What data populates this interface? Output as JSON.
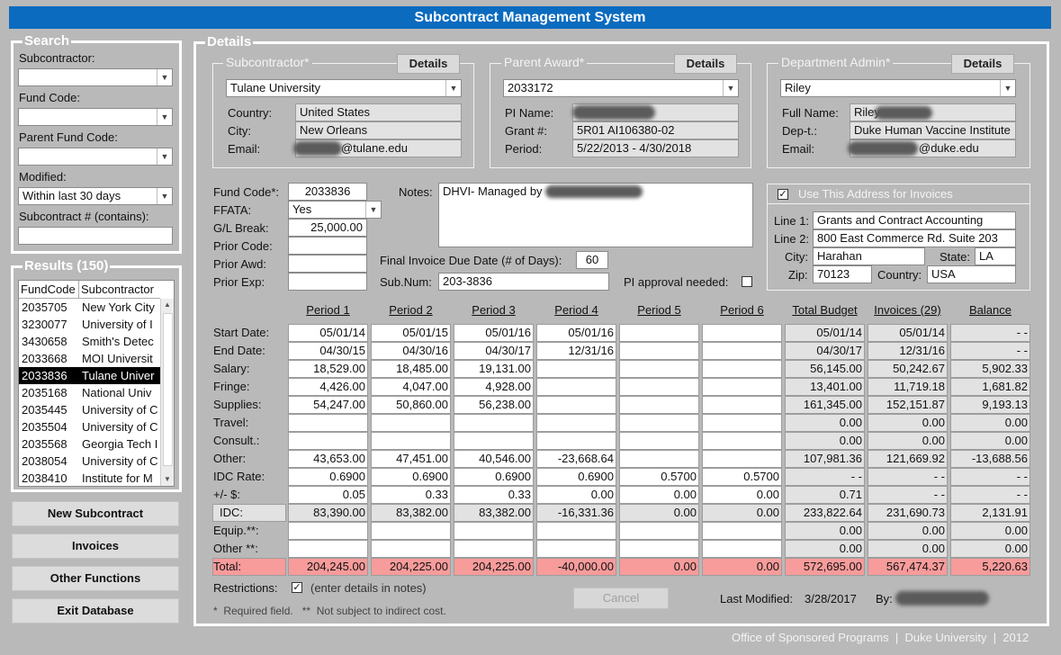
{
  "app_title": "Subcontract Management System",
  "search": {
    "legend": "Search",
    "subcontractor_label": "Subcontractor:",
    "subcontractor_value": "",
    "fund_code_label": "Fund Code:",
    "fund_code_value": "",
    "parent_fund_code_label": "Parent Fund Code:",
    "parent_fund_code_value": "",
    "modified_label": "Modified:",
    "modified_value": "Within last 30 days",
    "subcontract_num_label": "Subcontract # (contains):",
    "subcontract_num_value": ""
  },
  "results": {
    "legend": "Results (150)",
    "col_fundcode": "FundCode",
    "col_subcontractor": "Subcontractor",
    "rows": [
      {
        "code": "2035705",
        "name": "New York City"
      },
      {
        "code": "3230077",
        "name": "University of I"
      },
      {
        "code": "3430658",
        "name": "Smith's Detec"
      },
      {
        "code": "2033668",
        "name": "MOI Universit"
      },
      {
        "code": "2033836",
        "name": "Tulane Univer"
      },
      {
        "code": "2035168",
        "name": "National Univ"
      },
      {
        "code": "2035445",
        "name": "University of C"
      },
      {
        "code": "2035504",
        "name": "University of C"
      },
      {
        "code": "2035568",
        "name": "Georgia Tech I"
      },
      {
        "code": "2038054",
        "name": "University of C"
      },
      {
        "code": "2038410",
        "name": "Institute for M"
      }
    ]
  },
  "buttons": {
    "new_subcontract": "New Subcontract",
    "invoices": "Invoices",
    "other_functions": "Other Functions",
    "exit_database": "Exit Database",
    "details": "Details",
    "cancel": "Cancel"
  },
  "details": {
    "legend": "Details",
    "subcontractor": {
      "legend": "Subcontractor*",
      "value": "Tulane University",
      "country_label": "Country:",
      "country": "United States",
      "city_label": "City:",
      "city": "New Orleans",
      "email_label": "Email:",
      "email": "@tulane.edu"
    },
    "parent_award": {
      "legend": "Parent Award*",
      "value": "2033172",
      "pi_name_label": "PI Name:",
      "pi_name": "",
      "grant_label": "Grant #:",
      "grant": "5R01 AI106380-02",
      "period_label": "Period:",
      "period": "5/22/2013 - 4/30/2018"
    },
    "dept_admin": {
      "legend": "Department Admin*",
      "value": "Riley",
      "full_name_label": "Full Name:",
      "full_name": "Riley",
      "dept_label": "Dep-t.:",
      "dept": "Duke Human Vaccine Institute",
      "email_label": "Email:",
      "email": "@duke.edu"
    },
    "fund_code_label": "Fund Code*:",
    "fund_code": "2033836",
    "ffata_label": "FFATA:",
    "ffata": "Yes",
    "gl_break_label": "G/L Break:",
    "gl_break": "25,000.00",
    "prior_code_label": "Prior Code:",
    "prior_code": "",
    "prior_awd_label": "Prior Awd:",
    "prior_awd": "",
    "prior_exp_label": "Prior Exp:",
    "prior_exp": "",
    "notes_label": "Notes:",
    "notes": "DHVI- Managed by",
    "final_invoice_label": "Final Invoice Due Date (# of Days):",
    "final_invoice_days": "60",
    "subnum_label": "Sub.Num:",
    "subnum": "203-3836",
    "pi_approval_label": "PI approval needed:",
    "pi_approval_checked": false,
    "address": {
      "use_label": "Use This Address for Invoices",
      "use_checked": true,
      "line1_label": "Line 1:",
      "line1": "Grants and Contract Accounting",
      "line2_label": "Line 2:",
      "line2": "800 East Commerce Rd. Suite 203",
      "city_label": "City:",
      "city": "Harahan",
      "state_label": "State:",
      "state": "LA",
      "zip_label": "Zip:",
      "zip": "70123",
      "country_label": "Country:",
      "country": "USA"
    }
  },
  "budget": {
    "headers": [
      "Period 1",
      "Period 2",
      "Period 3",
      "Period 4",
      "Period 5",
      "Period 6",
      "Total Budget",
      "Invoices (29)",
      "Balance"
    ],
    "rows": [
      {
        "label": "Start Date:",
        "values": [
          "05/01/14",
          "05/01/15",
          "05/01/16",
          "05/01/16",
          "",
          "",
          "05/01/14",
          "05/01/14",
          "- -"
        ]
      },
      {
        "label": "End Date:",
        "values": [
          "04/30/15",
          "04/30/16",
          "04/30/17",
          "12/31/16",
          "",
          "",
          "04/30/17",
          "12/31/16",
          "- -"
        ]
      },
      {
        "label": "Salary:",
        "values": [
          "18,529.00",
          "18,485.00",
          "19,131.00",
          "",
          "",
          "",
          "56,145.00",
          "50,242.67",
          "5,902.33"
        ]
      },
      {
        "label": "Fringe:",
        "values": [
          "4,426.00",
          "4,047.00",
          "4,928.00",
          "",
          "",
          "",
          "13,401.00",
          "11,719.18",
          "1,681.82"
        ]
      },
      {
        "label": "Supplies:",
        "values": [
          "54,247.00",
          "50,860.00",
          "56,238.00",
          "",
          "",
          "",
          "161,345.00",
          "152,151.87",
          "9,193.13"
        ]
      },
      {
        "label": "Travel:",
        "values": [
          "",
          "",
          "",
          "",
          "",
          "",
          "0.00",
          "0.00",
          "0.00"
        ]
      },
      {
        "label": "Consult.:",
        "values": [
          "",
          "",
          "",
          "",
          "",
          "",
          "0.00",
          "0.00",
          "0.00"
        ]
      },
      {
        "label": "Other:",
        "values": [
          "43,653.00",
          "47,451.00",
          "40,546.00",
          "-23,668.64",
          "",
          "",
          "107,981.36",
          "121,669.92",
          "-13,688.56"
        ]
      },
      {
        "label": "IDC Rate:",
        "values": [
          "0.6900",
          "0.6900",
          "0.6900",
          "0.6900",
          "0.5700",
          "0.5700",
          "- -",
          "- -",
          "- -"
        ]
      },
      {
        "label": "+/- $:",
        "values": [
          "0.05",
          "0.33",
          "0.33",
          "0.00",
          "0.00",
          "0.00",
          "0.71",
          "- -",
          "- -"
        ]
      },
      {
        "label": "IDC:",
        "values": [
          "83,390.00",
          "83,382.00",
          "83,382.00",
          "-16,331.36",
          "0.00",
          "0.00",
          "233,822.64",
          "231,690.73",
          "2,131.91"
        ]
      },
      {
        "label": "Equip.**:",
        "values": [
          "",
          "",
          "",
          "",
          "",
          "",
          "0.00",
          "0.00",
          "0.00"
        ]
      },
      {
        "label": "Other **:",
        "values": [
          "",
          "",
          "",
          "",
          "",
          "",
          "0.00",
          "0.00",
          "0.00"
        ]
      },
      {
        "label": "Total:",
        "values": [
          "204,245.00",
          "204,225.00",
          "204,225.00",
          "-40,000.00",
          "0.00",
          "0.00",
          "572,695.00",
          "567,474.37",
          "5,220.63"
        ]
      }
    ]
  },
  "restrictions_label": "Restrictions:",
  "restrictions_checked": true,
  "restrictions_hint": "(enter details in notes)",
  "last_modified_label": "Last Modified:",
  "last_modified": "3/28/2017",
  "by_label": "By:",
  "footnote": "*  Required field.   **  Not subject to indirect cost.",
  "footer": "Office of Sponsored Programs  |  Duke University  |  2012"
}
